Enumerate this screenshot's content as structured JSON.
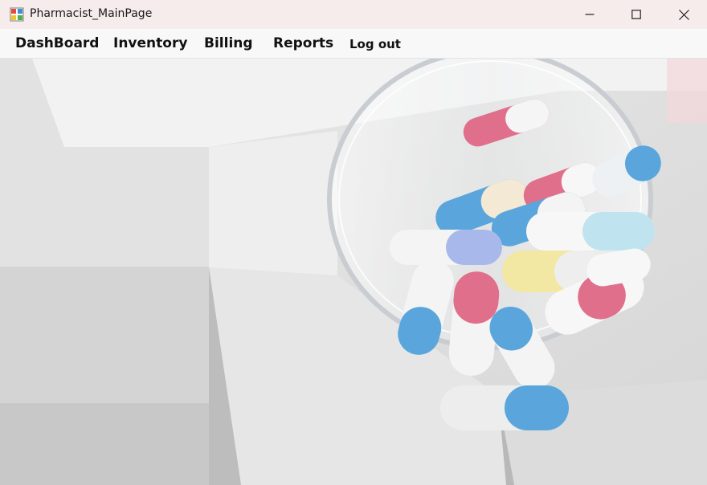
{
  "window": {
    "title": "Pharmacist_MainPage",
    "app_icon": "windows-form-icon",
    "controls": {
      "minimize": "minimize-icon",
      "maximize": "maximize-icon",
      "close": "close-icon"
    }
  },
  "menu": {
    "items": [
      {
        "label": "DashBoard"
      },
      {
        "label": "Inventory"
      },
      {
        "label": "Billing"
      },
      {
        "label": "Reports"
      },
      {
        "label": "Log out"
      }
    ]
  },
  "hero": {
    "image": "pills-spilling-from-glass-jar"
  },
  "colors": {
    "titlebar": "#f6ecec",
    "menubar": "#f8f8f8",
    "capsule_blue": "#5aa6dc",
    "capsule_pink": "#e0708e",
    "capsule_yellow": "#f2e6a0"
  }
}
